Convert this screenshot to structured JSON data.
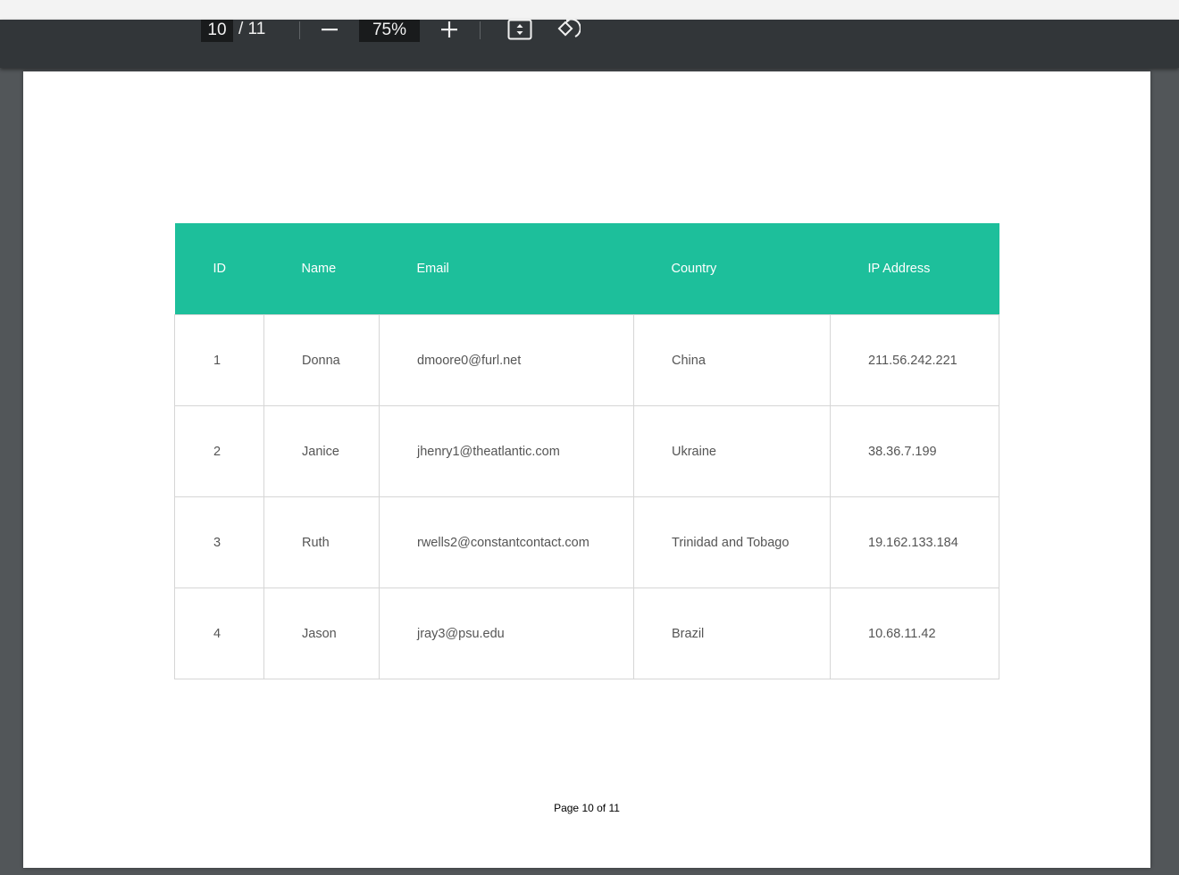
{
  "viewer": {
    "current_page": "10",
    "total_pages": "/ 11",
    "zoom": "75%",
    "icons": {
      "zoom_out": "minus-icon",
      "zoom_in": "plus-icon",
      "fit": "fit-to-page-icon",
      "rotate": "rotate-icon"
    }
  },
  "table": {
    "headers": [
      "ID",
      "Name",
      "Email",
      "Country",
      "IP Address"
    ],
    "rows": [
      [
        "1",
        "Donna",
        "dmoore0@furl.net",
        "China",
        "211.56.242.221"
      ],
      [
        "2",
        "Janice",
        "jhenry1@theatlantic.com",
        "Ukraine",
        "38.36.7.199"
      ],
      [
        "3",
        "Ruth",
        "rwells2@constantcontact.com",
        "Trinidad and Tobago",
        "19.162.133.184"
      ],
      [
        "4",
        "Jason",
        "jray3@psu.edu",
        "Brazil",
        "10.68.11.42"
      ]
    ]
  },
  "footer": {
    "page_label": "Page 10 of 11"
  },
  "colors": {
    "header_bg": "#1dbf9b",
    "toolbar_bg": "#323639",
    "viewer_bg": "#525659"
  }
}
